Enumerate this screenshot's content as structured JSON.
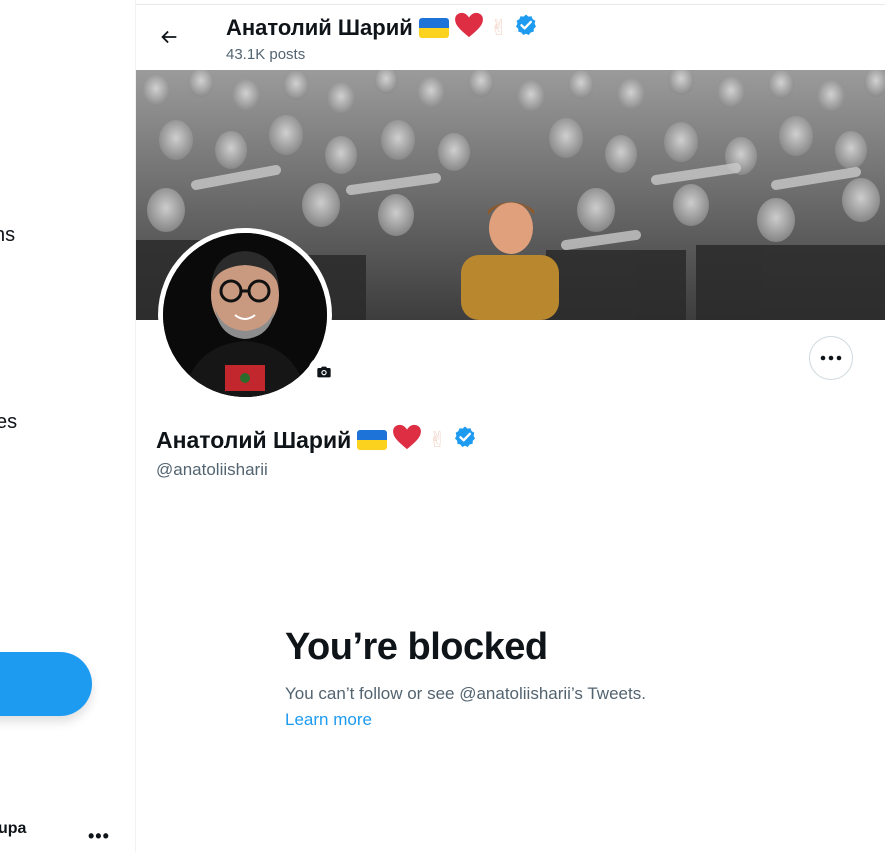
{
  "nav": {
    "item_partial_1": "ns",
    "item_partial_2": "es",
    "account_name_partial": "upa",
    "account_more": "•••"
  },
  "header": {
    "name": "Анатолий Шарий",
    "posts": "43.1K posts"
  },
  "profile": {
    "name": "Анатолий Шарий",
    "handle": "@anatoliisharii",
    "emojis": [
      "ukraine-flag",
      "red-heart",
      "victory-hand",
      "verified-badge"
    ]
  },
  "blocked": {
    "title": "You’re blocked",
    "description": "You can’t follow or see @anatoliisharii’s Tweets.",
    "link": "Learn more"
  },
  "colors": {
    "accent": "#1d9bf0",
    "secondary_text": "#536471",
    "flag_blue": "#1d73d8",
    "flag_yellow": "#fbd21e",
    "heart": "#dd2e44"
  }
}
